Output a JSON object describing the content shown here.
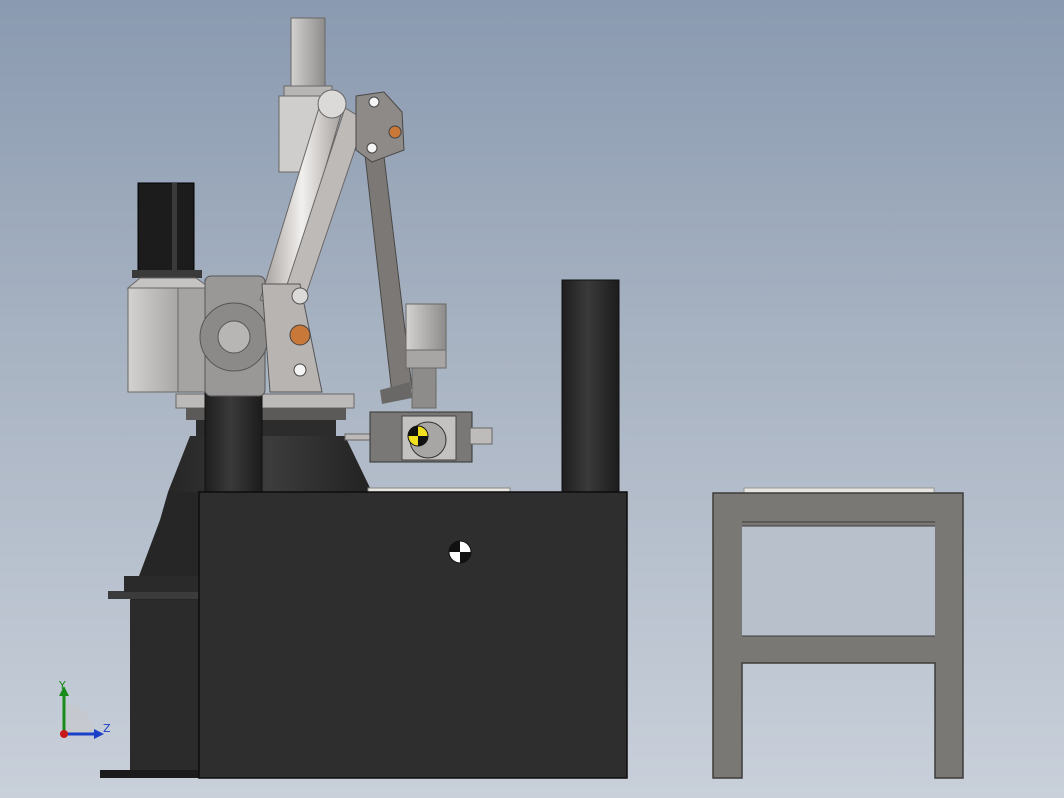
{
  "viewport": {
    "background_top": "#8a9ab0",
    "background_bottom": "#c9d0da"
  },
  "colors": {
    "column": "#2b2b2b",
    "cabinet": "#2e2e2e",
    "base_dark": "#1f1f1f",
    "arm_light": "#d9d6d4",
    "arm_mid": "#a8a4a2",
    "link_dark": "#6e6a68",
    "motor_black": "#1c1c1c",
    "motor_gray": "#b8b6b4",
    "table_frame": "#7a7874",
    "table_top": "#e8e6e2",
    "com_marker_yellow": "#f0e020"
  },
  "triad": {
    "y_axis": {
      "label": "Y",
      "color": "#1a8a1a"
    },
    "z_axis": {
      "label": "Z",
      "color": "#1a3fc8"
    },
    "x_axis": {
      "color": "#c81a1a"
    }
  },
  "icons": [
    "center-of-mass-icon",
    "center-of-mass-icon-gripper",
    "reference-triad-icon"
  ]
}
